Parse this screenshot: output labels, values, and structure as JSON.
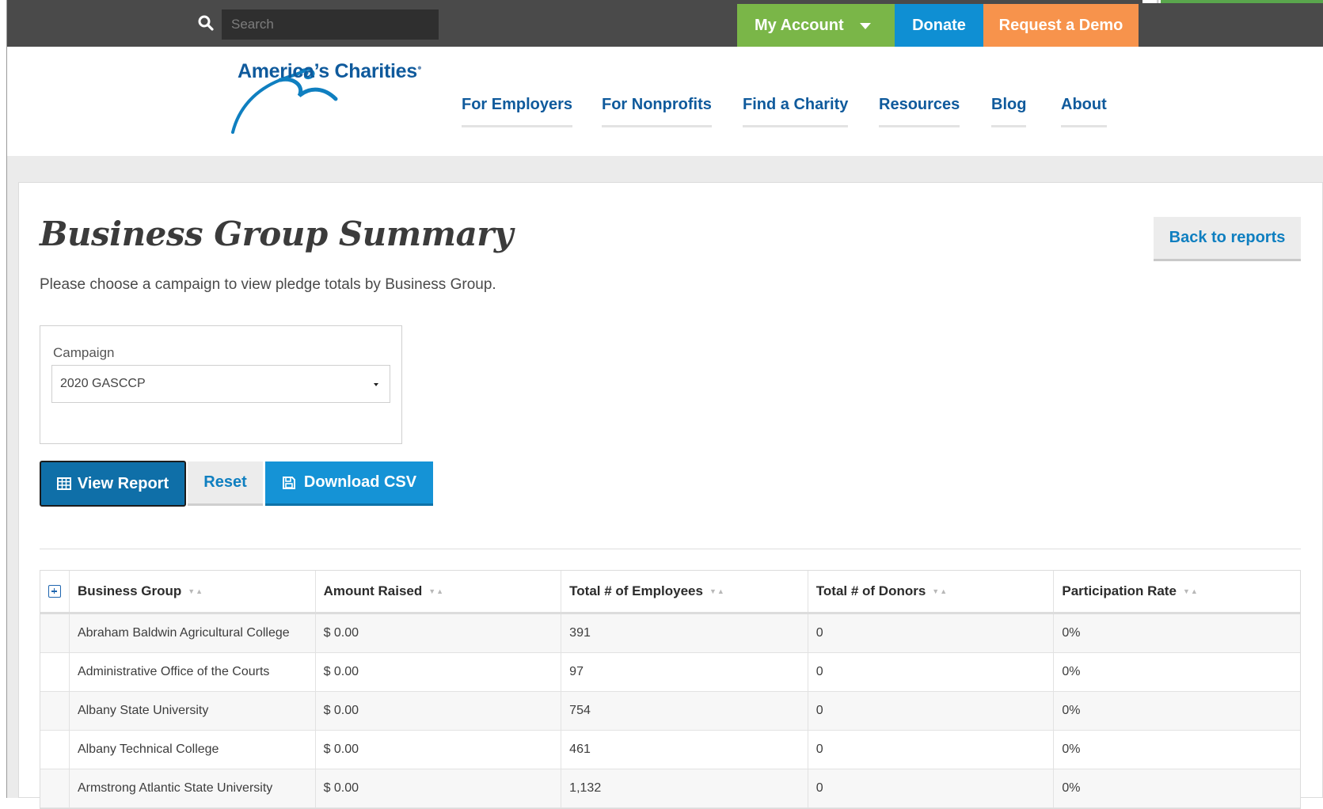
{
  "topbar": {
    "search_placeholder": "Search",
    "my_account": "My Account",
    "donate": "Donate",
    "request_demo": "Request a Demo"
  },
  "logo": {
    "text": "America’s Charities"
  },
  "nav": {
    "items": [
      "For Employers",
      "For Nonprofits",
      "Find a Charity",
      "Resources",
      "Blog",
      "About"
    ]
  },
  "page": {
    "title": "Business Group Summary",
    "back_button": "Back to reports",
    "intro": "Please choose a campaign to view pledge totals by Business Group."
  },
  "campaign": {
    "label": "Campaign",
    "selected": "2020 GASCCP"
  },
  "actions": {
    "view_report": "View Report",
    "reset": "Reset",
    "download_csv": "Download CSV"
  },
  "table": {
    "columns": [
      "Business Group",
      "Amount Raised",
      "Total # of Employees",
      "Total # of Donors",
      "Participation Rate"
    ],
    "rows": [
      [
        "Abraham Baldwin Agricultural College",
        "$ 0.00",
        "391",
        "0",
        "0%"
      ],
      [
        "Administrative Office of the Courts",
        "$ 0.00",
        "97",
        "0",
        "0%"
      ],
      [
        "Albany State University",
        "$ 0.00",
        "754",
        "0",
        "0%"
      ],
      [
        "Albany Technical College",
        "$ 0.00",
        "461",
        "0",
        "0%"
      ],
      [
        "Armstrong Atlantic State University",
        "$ 0.00",
        "1,132",
        "0",
        "0%"
      ]
    ]
  },
  "colors": {
    "topbar_bg": "#4a4a4a",
    "account_green": "#7ab648",
    "donate_blue": "#0f8fd3",
    "demo_orange": "#f7934c",
    "brand_blue": "#0f5a9c",
    "link_blue": "#0f7fc0"
  }
}
